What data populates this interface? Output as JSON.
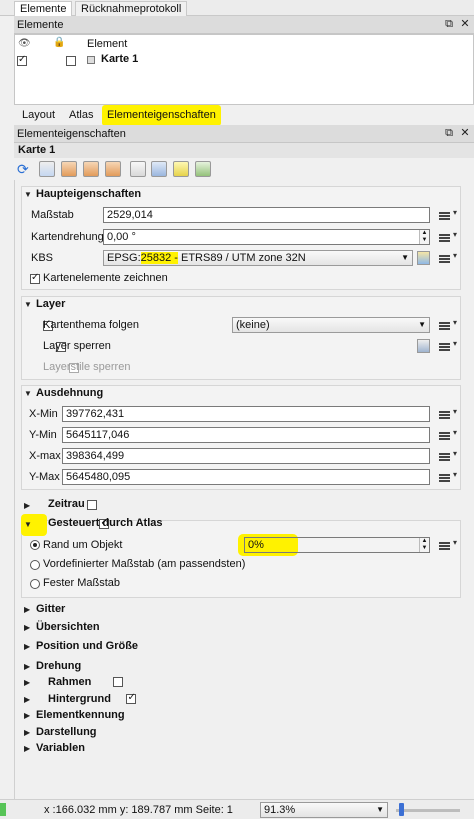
{
  "top_tabs": [
    "Elemente",
    "Rücknahmeprotokoll"
  ],
  "elements_panel": {
    "title": "Elemente",
    "columns": {
      "eye_icon": "eye-icon",
      "lock_icon": "lock-icon",
      "element": "Element"
    },
    "rows": [
      {
        "visible": true,
        "locked": false,
        "name": "Karte 1"
      }
    ]
  },
  "sub_tabs": [
    "Layout",
    "Atlas",
    "Elementeigenschaften"
  ],
  "props_panel": {
    "title": "Elementeigenschaften",
    "item_name": "Karte 1"
  },
  "toolbar_icons": [
    "refresh-icon",
    "set-extent-icon",
    "view-extent-icon",
    "move-content-icon",
    "bookmark-icon",
    "save-icon",
    "grid-icon",
    "label-icon",
    "layer-icon"
  ],
  "haupteigenschaften": {
    "title": "Haupteigenschaften",
    "massstab_label": "Maßstab",
    "massstab_value": "2529,014",
    "drehung_label": "Kartendrehung",
    "drehung_value": "0,00 °",
    "kbs_label": "KBS",
    "kbs_prefix": "EPSG:",
    "kbs_code": "25832 -",
    "kbs_rest": " ETRS89 / UTM zone 32N",
    "zeichnen_label": "Kartenelemente zeichnen",
    "zeichnen_checked": true
  },
  "layer": {
    "title": "Layer",
    "thema_label": "Kartenthema folgen",
    "thema_value": "(keine)",
    "sperren_label": "Layer sperren",
    "stile_label": "Layerstile sperren"
  },
  "ausdehnung": {
    "title": "Ausdehnung",
    "rows": [
      {
        "label": "X-Min",
        "value": "397762,431"
      },
      {
        "label": "Y-Min",
        "value": "5645117,046"
      },
      {
        "label": "X-max",
        "value": "398364,499"
      },
      {
        "label": "Y-Max",
        "value": "5645480,095"
      }
    ]
  },
  "zeitraum": {
    "title": "Zeitrau",
    "checked": false
  },
  "atlas": {
    "title": "Gesteuert durch Atlas",
    "checked": true,
    "opt1": "Rand um Objekt",
    "opt1_value": "0%",
    "opt2": "Vordefinierter Maßstab (am passendsten)",
    "opt3": "Fester Maßstab",
    "selected": "Rand um Objekt"
  },
  "collapsed_sections": [
    {
      "title": "Gitter",
      "checkbox": null
    },
    {
      "title": "Übersichten",
      "checkbox": null
    },
    {
      "title": "Position und Größe",
      "checkbox": null
    },
    {
      "title": "Drehung",
      "checkbox": null
    },
    {
      "title": "Rahmen",
      "checkbox": false
    },
    {
      "title": "Hintergrund",
      "checkbox": true
    },
    {
      "title": "Elementkennung",
      "checkbox": null
    },
    {
      "title": "Darstellung",
      "checkbox": null
    },
    {
      "title": "Variablen",
      "checkbox": null
    }
  ],
  "status": {
    "coords": "x :166.032 mm y: 189.787 mm Seite: 1",
    "zoom": "91.3%",
    "zoom_slider_fraction": 0.05
  },
  "colors": {
    "highlight": "#fff200",
    "accent": "#3b6fd4"
  }
}
